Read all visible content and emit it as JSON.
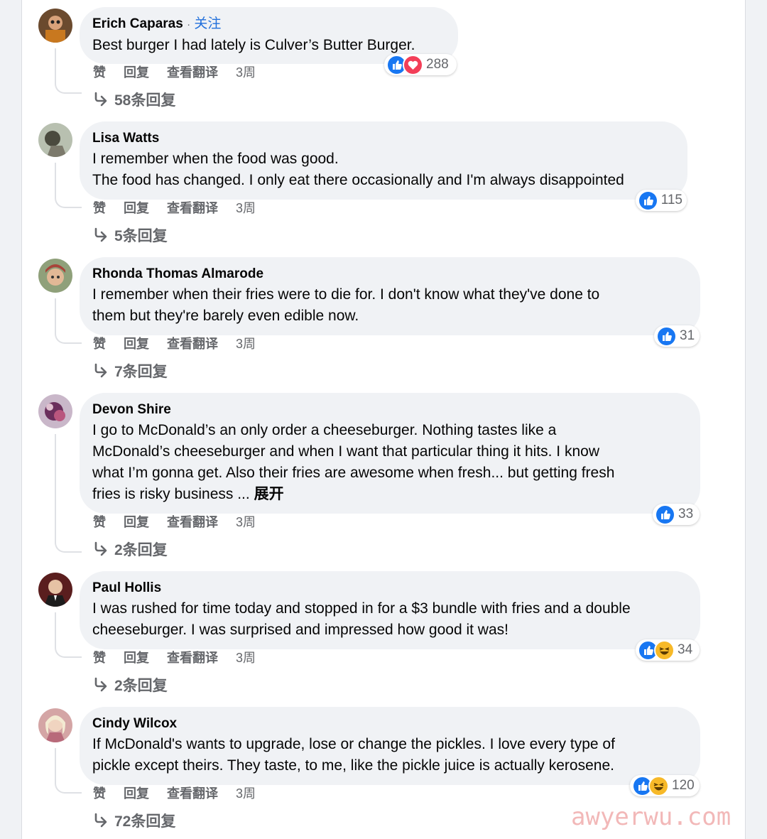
{
  "labels": {
    "like": "赞",
    "reply": "回复",
    "translate": "查看翻译",
    "follow": "关注",
    "follow_dot": "·",
    "see_more": "展开"
  },
  "comments": [
    {
      "author": "Erich Caparas",
      "lines": [
        "Best burger I had lately is Culver’s Butter Burger."
      ],
      "reactions": [
        "like",
        "love"
      ],
      "reaction_count": "288",
      "time": "3周",
      "replies": "58条回复"
    },
    {
      "author": "Lisa Watts",
      "lines": [
        "I remember when the food was good.",
        "The food has changed. I only eat there occasionally and I'm always disappointed"
      ],
      "reactions": [
        "like"
      ],
      "reaction_count": "115",
      "time": "3周",
      "replies": "5条回复"
    },
    {
      "author": "Rhonda Thomas Almarode",
      "lines": [
        "I remember when their fries were to die for. I don't know what they've done to",
        "them but they're barely even edible now."
      ],
      "reactions": [
        "like"
      ],
      "reaction_count": "31",
      "time": "3周",
      "replies": "7条回复"
    },
    {
      "author": "Devon Shire",
      "lines": [
        "I go to McDonald’s an only order a cheeseburger. Nothing tastes like a",
        "McDonald’s cheeseburger and when I want that particular thing it hits. I know",
        "what I’m gonna get. Also their fries are awesome when fresh... but getting fresh",
        "fries is risky business ..."
      ],
      "reactions": [
        "like"
      ],
      "reaction_count": "33",
      "time": "3周",
      "replies": "2条回复"
    },
    {
      "author": "Paul Hollis",
      "lines": [
        "I was rushed for time today and stopped in for a $3 bundle with fries and a double",
        "cheeseburger. I was surprised and impressed how good it was!"
      ],
      "reactions": [
        "like",
        "haha"
      ],
      "reaction_count": "34",
      "time": "3周",
      "replies": "2条回复"
    },
    {
      "author": "Cindy Wilcox",
      "lines": [
        "If McDonald's wants to upgrade, lose or change the pickles. I love every type of",
        "pickle except theirs. They taste, to me, like the pickle juice is actually kerosene."
      ],
      "reactions": [
        "like",
        "haha"
      ],
      "reaction_count": "120",
      "time": "3周",
      "replies": "72条回复"
    }
  ],
  "colors": {
    "like": "#1877f2",
    "love": "#f33e58",
    "haha": "#f7b928",
    "follow": "#216fdb",
    "muted": "#65676b"
  },
  "icons": {
    "like": "thumbs-up-icon",
    "love": "heart-icon",
    "haha": "laughing-face-icon",
    "replies": "reply-arrow-icon"
  },
  "watermark": "awyerwu.com"
}
